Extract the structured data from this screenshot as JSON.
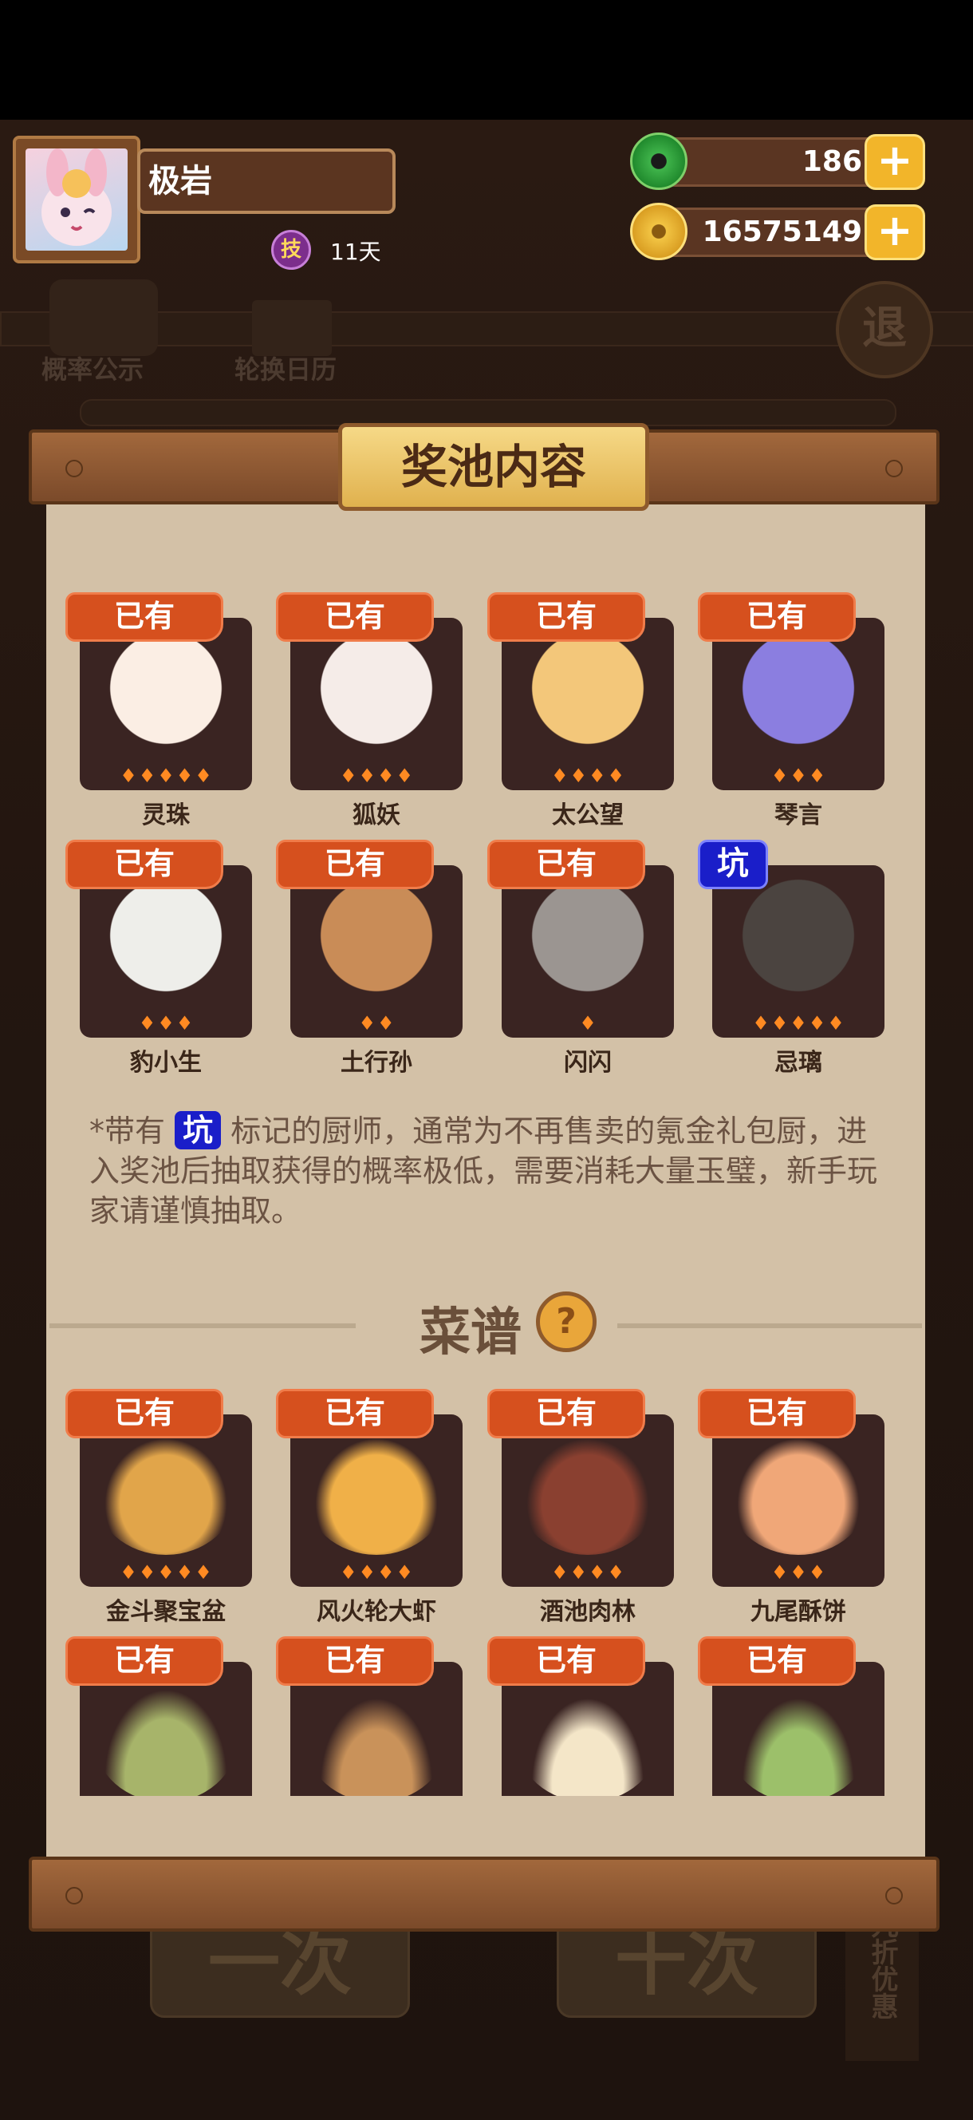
{
  "player": {
    "name": "极岩",
    "skill_icon_text": "技",
    "days": "11天"
  },
  "resources": {
    "jade": "186",
    "coins": "16575149",
    "plus": "+"
  },
  "background": {
    "prob_label": "概率公示",
    "calendar_label": "轮换日历",
    "exit_label": "退",
    "btn_once": "一次",
    "btn_ten": "十次",
    "side_tab": "九折优惠"
  },
  "dialog": {
    "title": "奖池内容",
    "chefs": [
      {
        "name": "灵珠",
        "badge": "已有",
        "stars": 5
      },
      {
        "name": "狐妖",
        "badge": "已有",
        "stars": 4
      },
      {
        "name": "太公望",
        "badge": "已有",
        "stars": 4
      },
      {
        "name": "琴言",
        "badge": "已有",
        "stars": 3
      },
      {
        "name": "豹小生",
        "badge": "已有",
        "stars": 3
      },
      {
        "name": "土行孙",
        "badge": "已有",
        "stars": 2
      },
      {
        "name": "闪闪",
        "badge": "已有",
        "stars": 1
      },
      {
        "name": "忌璃",
        "badge": "坑",
        "stars": 5
      }
    ],
    "note_prefix": "*带有",
    "note_tag": "坑",
    "note_text": "标记的厨师，通常为不再售卖的氪金礼包厨，进入奖池后抽取获得的概率极低，需要消耗大量玉璧，新手玩家请谨慎抽取。",
    "recipe_title": "菜谱",
    "help": "?",
    "recipes": [
      {
        "name": "金斗聚宝盆",
        "badge": "已有",
        "stars": 5
      },
      {
        "name": "风火轮大虾",
        "badge": "已有",
        "stars": 4
      },
      {
        "name": "酒池肉林",
        "badge": "已有",
        "stars": 4
      },
      {
        "name": "九尾酥饼",
        "badge": "已有",
        "stars": 3
      },
      {
        "name": "",
        "badge": "已有",
        "stars": 0
      },
      {
        "name": "",
        "badge": "已有",
        "stars": 0
      },
      {
        "name": "",
        "badge": "已有",
        "stars": 0
      },
      {
        "name": "",
        "badge": "已有",
        "stars": 0
      }
    ]
  },
  "colors": {
    "badge_owned": "#d6501e",
    "badge_keng": "#1a1ec9",
    "card_bg": "#3a2422",
    "paper": "#d3c1a7"
  }
}
